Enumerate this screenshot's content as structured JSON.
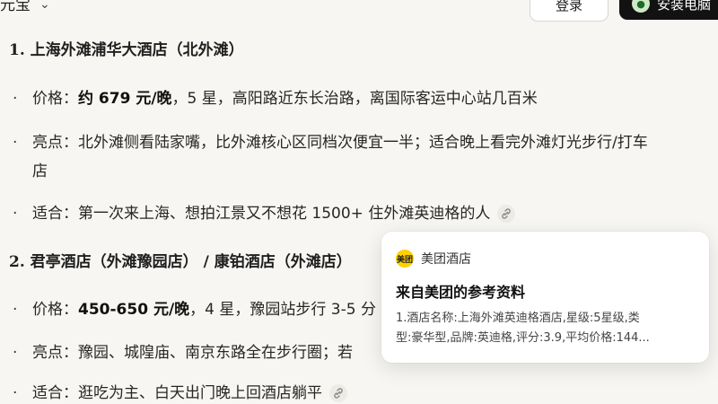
{
  "header": {
    "model_name": "元宝",
    "login_label": "登录",
    "install_label": "安装电脑"
  },
  "sections": [
    {
      "title": "1. 上海外滩浦华大酒店（北外滩）",
      "price_label": "价格：",
      "price_value": "约 679 元/晚",
      "price_rest": "，5 星，高阳路近东长治路，离国际客运中心站几百米",
      "highlight_label": "亮点：",
      "highlight_text": "北外滩侧看陆家嘴，比外滩核心区同档次便宜一半；适合晚上看完外滩灯光步行/打车",
      "highlight_cont": "店",
      "fit_label": "适合：",
      "fit_text": "第一次来上海、想拍江景又不想花 1500+ 住外滩英迪格的人"
    },
    {
      "title": "2. 君亭酒店（外滩豫园店） / 康铂酒店（外滩店）",
      "price_label": "价格：",
      "price_value": "450-650 元/晚",
      "price_rest": "，4 星，豫园站步行 3-5 分",
      "highlight_label": "亮点：",
      "highlight_text": "豫园、城隍庙、南京东路全在步行圈；若",
      "fit_label": "适合：",
      "fit_text": "逛吃为主、白天出门晚上回酒店躺平"
    }
  ],
  "popup": {
    "source_name": "美团酒店",
    "source_logo_text": "美团",
    "title": "来自美团的参考资料",
    "desc_line1": "1.酒店名称:上海外滩英迪格酒店,星级:5星级,类",
    "desc_line2": "型:豪华型,品牌:英迪格,评分:3.9,平均价格:144..."
  }
}
